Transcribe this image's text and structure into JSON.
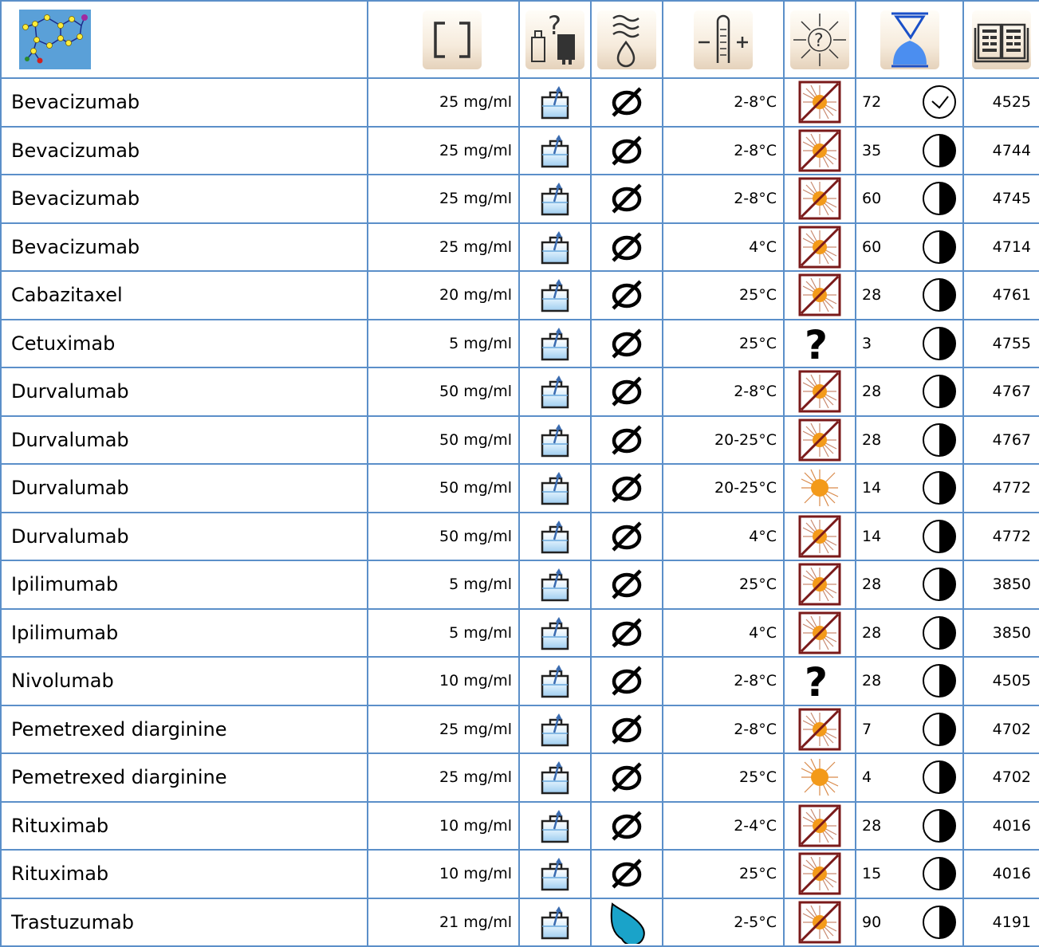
{
  "header": {
    "icons": [
      "molecule-icon",
      "concentration-icon",
      "container-icon",
      "solvent-icon",
      "temperature-icon",
      "light-icon",
      "duration-icon",
      "reference-icon"
    ]
  },
  "rows": [
    {
      "name": "Bevacizumab",
      "conc": "25 mg/ml",
      "solvent": "none",
      "temp": "2-8°C",
      "light": "protected",
      "days": "72",
      "time": "hours",
      "ref": "4525"
    },
    {
      "name": "Bevacizumab",
      "conc": "25 mg/ml",
      "solvent": "none",
      "temp": "2-8°C",
      "light": "protected",
      "days": "35",
      "time": "days",
      "ref": "4744"
    },
    {
      "name": "Bevacizumab",
      "conc": "25 mg/ml",
      "solvent": "none",
      "temp": "2-8°C",
      "light": "protected",
      "days": "60",
      "time": "days",
      "ref": "4745"
    },
    {
      "name": "Bevacizumab",
      "conc": "25 mg/ml",
      "solvent": "none",
      "temp": "4°C",
      "light": "protected",
      "days": "60",
      "time": "days",
      "ref": "4714"
    },
    {
      "name": "Cabazitaxel",
      "conc": "20 mg/ml",
      "solvent": "none",
      "temp": "25°C",
      "light": "protected",
      "days": "28",
      "time": "days",
      "ref": "4761"
    },
    {
      "name": "Cetuximab",
      "conc": "5 mg/ml",
      "solvent": "none",
      "temp": "25°C",
      "light": "unknown",
      "days": "3",
      "time": "days",
      "ref": "4755"
    },
    {
      "name": "Durvalumab",
      "conc": "50 mg/ml",
      "solvent": "none",
      "temp": "2-8°C",
      "light": "protected",
      "days": "28",
      "time": "days",
      "ref": "4767"
    },
    {
      "name": "Durvalumab",
      "conc": "50 mg/ml",
      "solvent": "none",
      "temp": "20-25°C",
      "light": "protected",
      "days": "28",
      "time": "days",
      "ref": "4767"
    },
    {
      "name": "Durvalumab",
      "conc": "50 mg/ml",
      "solvent": "none",
      "temp": "20-25°C",
      "light": "exposed",
      "days": "14",
      "time": "days",
      "ref": "4772"
    },
    {
      "name": "Durvalumab",
      "conc": "50 mg/ml",
      "solvent": "none",
      "temp": "4°C",
      "light": "protected",
      "days": "14",
      "time": "days",
      "ref": "4772"
    },
    {
      "name": "Ipilimumab",
      "conc": "5 mg/ml",
      "solvent": "none",
      "temp": "25°C",
      "light": "protected",
      "days": "28",
      "time": "days",
      "ref": "3850"
    },
    {
      "name": "Ipilimumab",
      "conc": "5 mg/ml",
      "solvent": "none",
      "temp": "4°C",
      "light": "protected",
      "days": "28",
      "time": "days",
      "ref": "3850"
    },
    {
      "name": "Nivolumab",
      "conc": "10 mg/ml",
      "solvent": "none",
      "temp": "2-8°C",
      "light": "unknown",
      "days": "28",
      "time": "days",
      "ref": "4505"
    },
    {
      "name": "Pemetrexed diarginine",
      "conc": "25 mg/ml",
      "solvent": "none",
      "temp": "2-8°C",
      "light": "protected",
      "days": "7",
      "time": "days",
      "ref": "4702"
    },
    {
      "name": "Pemetrexed diarginine",
      "conc": "25 mg/ml",
      "solvent": "none",
      "temp": "25°C",
      "light": "exposed",
      "days": "4",
      "time": "days",
      "ref": "4702"
    },
    {
      "name": "Rituximab",
      "conc": "10 mg/ml",
      "solvent": "none",
      "temp": "2-4°C",
      "light": "protected",
      "days": "28",
      "time": "days",
      "ref": "4016"
    },
    {
      "name": "Rituximab",
      "conc": "10 mg/ml",
      "solvent": "none",
      "temp": "25°C",
      "light": "protected",
      "days": "15",
      "time": "days",
      "ref": "4016"
    },
    {
      "name": "Trastuzumab",
      "conc": "21 mg/ml",
      "solvent": "drop",
      "temp": "2-5°C",
      "light": "protected",
      "days": "90",
      "time": "days",
      "ref": "4191"
    }
  ]
}
